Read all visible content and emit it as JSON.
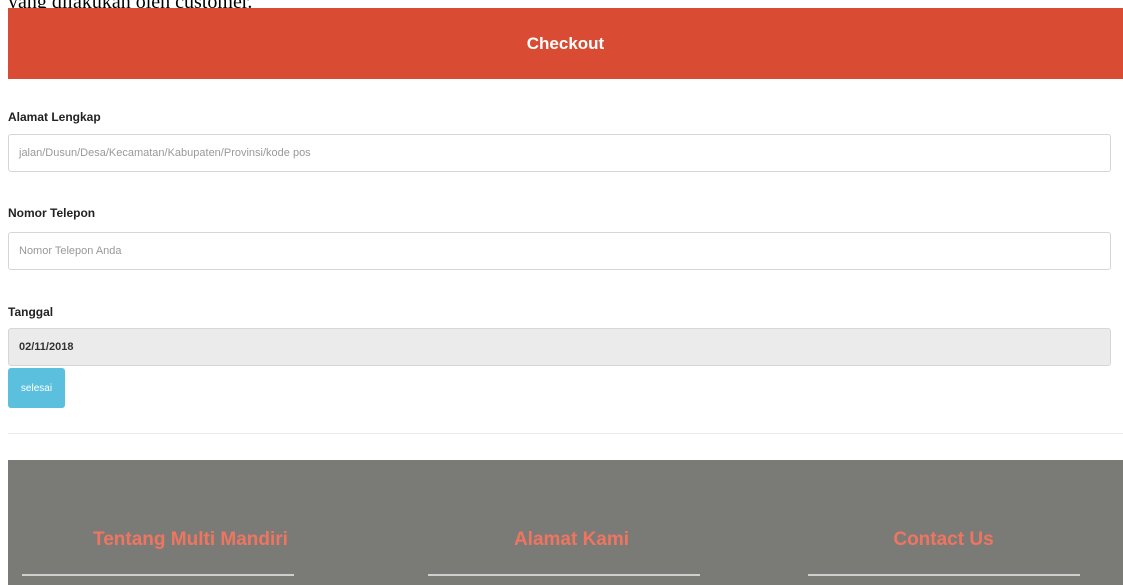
{
  "document": {
    "caption_fragment": "yang dilakukan oleh customer."
  },
  "header": {
    "title": "Checkout"
  },
  "form": {
    "address": {
      "label": "Alamat Lengkap",
      "placeholder": "jalan/Dusun/Desa/Kecamatan/Kabupaten/Provinsi/kode pos"
    },
    "phone": {
      "label": "Nomor Telepon",
      "placeholder": "Nomor Telepon Anda"
    },
    "date": {
      "label": "Tanggal",
      "value": "02/11/2018"
    },
    "submit_label": "selesai"
  },
  "footer": {
    "col1_title": "Tentang Multi Mandiri",
    "col2_title": "Alamat Kami",
    "col3_title": "Contact Us"
  },
  "colors": {
    "header_bg": "#d94c33",
    "button_bg": "#5bc0de",
    "footer_bg": "#7a7a77",
    "footer_title": "#f07560"
  }
}
